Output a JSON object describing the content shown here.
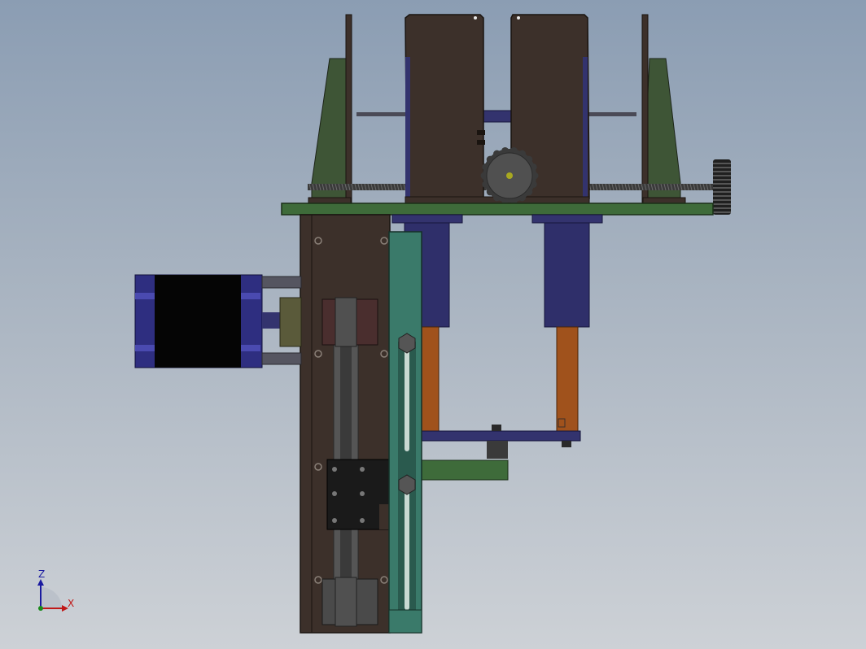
{
  "viewport": {
    "background_top": "#8b9db3",
    "background_bottom": "#cdd1d6"
  },
  "colors": {
    "frame_brown": "#3c302a",
    "plate_green": "#3e6b3a",
    "bracket_green": "#3e5536",
    "slider_teal": "#3a7a6a",
    "actuator_blue": "#33336e",
    "rod_orange": "#a0521c",
    "motor_black": "#050505",
    "motor_cap": "#2e2e80",
    "belt_gray": "#555555"
  },
  "model": {
    "parts": [
      "left-side-bracket",
      "right-side-bracket",
      "left-clamp-jaw",
      "right-clamp-jaw",
      "lead-screw",
      "guide-rod",
      "hand-wheel",
      "gear",
      "base-plate",
      "vertical-frame",
      "stepper-motor",
      "timing-belt",
      "linear-guide-rail",
      "pneumatic-cylinder-left",
      "pneumatic-cylinder-right",
      "carriage-block"
    ]
  },
  "triad": {
    "z_label": "Z",
    "x_label": "X",
    "z_color": "#1a1aa0",
    "x_color": "#c01818"
  }
}
